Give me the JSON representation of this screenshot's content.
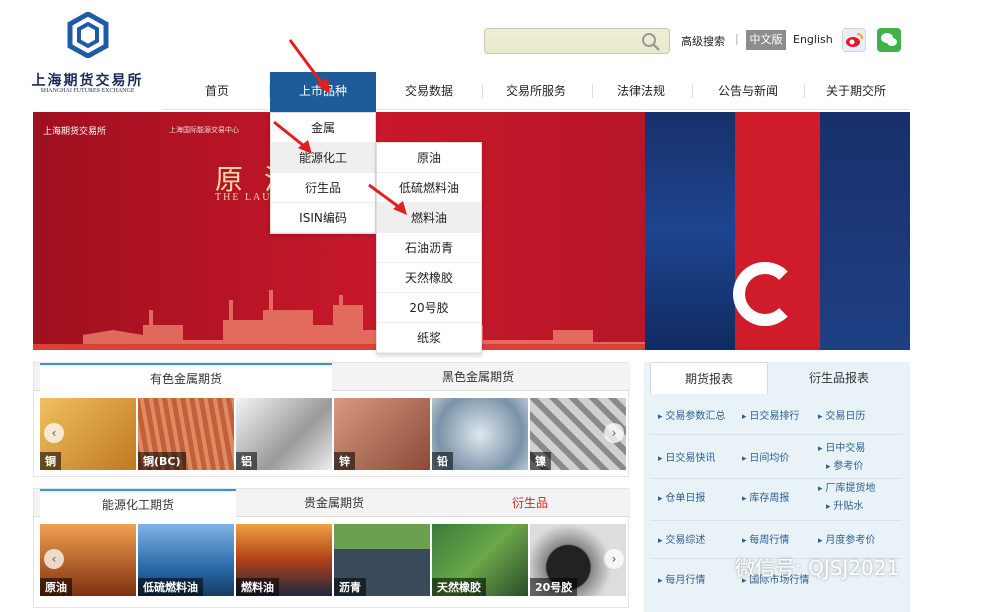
{
  "header": {
    "logo_cn": "上海期货交易所",
    "logo_en": "SHANGHAI FUTURES EXCHANGE",
    "advanced_search": "高级搜索",
    "separator": "|",
    "lang_cn": "中文版",
    "lang_en": "English"
  },
  "nav": [
    "首页",
    "上市品种",
    "交易数据",
    "交易所服务",
    "法律法规",
    "公告与新闻",
    "关于期交所"
  ],
  "dropdown_l1": [
    "金属",
    "能源化工",
    "衍生品",
    "ISIN编码"
  ],
  "dropdown_l2": [
    "原油",
    "低硫燃料油",
    "燃料油",
    "石油沥青",
    "天然橡胶",
    "20号胶",
    "纸浆"
  ],
  "banner": {
    "logo": "上海期货交易所",
    "logo2": "上海国际能源交易中心",
    "title": "原 油",
    "subtitle": "THE LAU"
  },
  "panel_metals": {
    "tabs": [
      "有色金属期货",
      "黑色金属期货"
    ],
    "items": [
      "铜",
      "铜(BC)",
      "铝",
      "锌",
      "铅",
      "镍"
    ]
  },
  "panel_energy": {
    "tabs": [
      "能源化工期货",
      "贵金属期货",
      "衍生品"
    ],
    "items": [
      "原油",
      "低硫燃料油",
      "燃料油",
      "沥青",
      "天然橡胶",
      "20号胶"
    ]
  },
  "reports": {
    "tabs": [
      "期货报表",
      "衍生品报表"
    ],
    "links": [
      "交易参数汇总",
      "日交易排行",
      "交易日历",
      "日交易快讯",
      "日间均价",
      "日中交易",
      "参考价",
      "仓单日报",
      "库存周报",
      "厂库提货地",
      "升贴水",
      "交易综述",
      "每周行情",
      "月度参考价",
      "每月行情",
      "国际市场行情"
    ]
  },
  "watermark": "微信号: QJSJ2021",
  "colors": {
    "nav_active": "#1d5b99",
    "banner_red": "#c8182a",
    "tab_accent": "#2a9bd6",
    "derivative_red": "#d62020"
  }
}
